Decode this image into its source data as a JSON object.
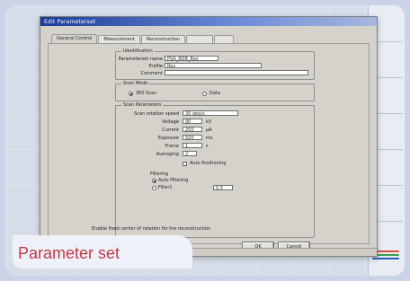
{
  "window": {
    "title": "Edit Parameterset",
    "tabs": [
      {
        "label": "General Control"
      },
      {
        "label": "Measurement"
      },
      {
        "label": "Reconstruction"
      },
      {
        "label": ""
      },
      {
        "label": ""
      }
    ]
  },
  "identification": {
    "group_title": "Identification",
    "fields": [
      {
        "label": "Parameterset name",
        "value": "PSA_RDB_Rex"
      },
      {
        "label": "Profile",
        "value": "Rex"
      },
      {
        "label": "Comment",
        "value": ""
      }
    ]
  },
  "scan_mode": {
    "group_title": "Scan Mode",
    "options": [
      {
        "label": "360 Scan",
        "selected": true
      },
      {
        "label": "Data",
        "selected": false
      }
    ]
  },
  "parameters": {
    "group_title": "Scan Parameters",
    "fields": [
      {
        "label": "Scan rotation speed",
        "value": "30 deg/s",
        "unit": ""
      },
      {
        "label": "Voltage",
        "value": "90",
        "unit": "kV"
      },
      {
        "label": "Current",
        "value": "200",
        "unit": "µA"
      },
      {
        "label": "Exposure",
        "value": "500",
        "unit": "ms"
      },
      {
        "label": "Frame",
        "value": "1",
        "unit": "s"
      },
      {
        "label": "Averaging",
        "value": "2",
        "unit": ""
      }
    ],
    "checkbox_label": "Auto Positioning",
    "sub_group_title": "Filtering",
    "sub_options": [
      {
        "label": "Auto Filtering",
        "selected": true
      },
      {
        "label": "Filter1",
        "selected": false
      }
    ],
    "sub_value": "0.5"
  },
  "dialog": {
    "footer_checkbox": "Enable fixed center of rotation for the reconstruction",
    "ok_label": "OK",
    "cancel_label": "Cancel",
    "status_text": ""
  },
  "caption": {
    "text": "Parameter set"
  }
}
